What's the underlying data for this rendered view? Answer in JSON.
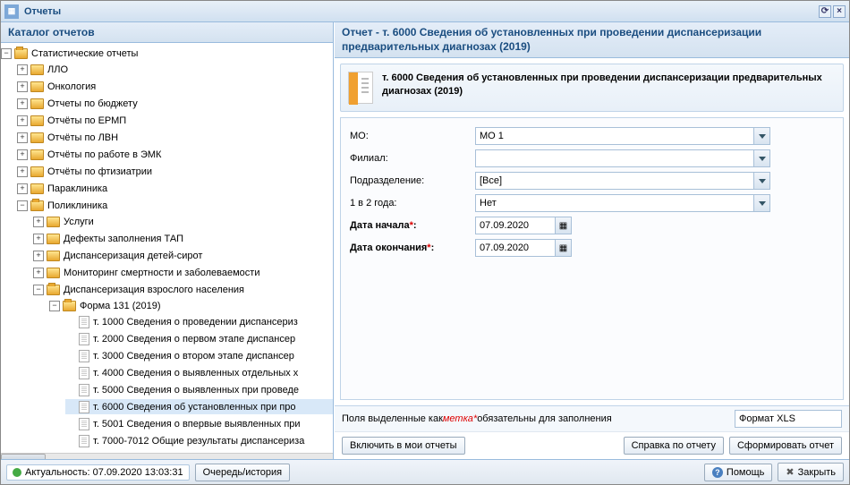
{
  "window": {
    "title": "Отчеты"
  },
  "catalog": {
    "title": "Каталог отчетов",
    "root": "Статистические отчеты",
    "folders": [
      "ЛЛО",
      "Онкология",
      "Отчеты по бюджету",
      "Отчёты по ЕРМП",
      "Отчёты по ЛВН",
      "Отчёты по работе в ЭМК",
      "Отчёты по фтизиатрии",
      "Параклиника"
    ],
    "poli": "Поликлиника",
    "poli_sub": [
      "Услуги",
      "Дефекты заполнения ТАП",
      "Диспансеризация детей-сирот",
      "Мониторинг смертности и заболеваемости"
    ],
    "dvn": "Диспансеризация взрослого населения",
    "form131": "Форма 131 (2019)",
    "docs": [
      "т. 1000 Сведения о проведении диспансериз",
      "т. 2000 Сведения о первом этапе диспансер",
      "т. 3000 Сведения о втором этапе диспансер",
      "т. 4000 Сведения о выявленных отдельных х",
      "т. 5000 Сведения о выявленных при проведе",
      "т. 6000 Сведения об установленных при про",
      "т. 5001 Сведения о впервые выявленных при",
      "т. 7000-7012 Общие результаты диспансериза"
    ],
    "selected_index": 5
  },
  "report": {
    "title": "Отчет - т. 6000 Сведения об установленных при проведении диспансеризации предварительных диагнозах (2019)",
    "info": "т. 6000 Сведения об установленных при проведении диспансеризации предварительных диагнозах (2019)",
    "fields": {
      "mo_label": "МО:",
      "mo_value": "МО 1",
      "filial_label": "Филиал:",
      "filial_value": "",
      "podr_label": "Подразделение:",
      "podr_value": "[Все]",
      "freq_label": "1 в 2 года:",
      "freq_value": "Нет",
      "start_label": "Дата начала",
      "start_value": "07.09.2020",
      "end_label": "Дата окончания",
      "end_value": "07.09.2020"
    },
    "hint_prefix": "Поля выделенные как ",
    "hint_badge": "метка*",
    "hint_suffix": " обязательны для заполнения",
    "format": "Формат XLS"
  },
  "buttons": {
    "include": "Включить в мои отчеты",
    "help_report": "Справка по отчету",
    "form": "Сформировать отчет",
    "queue": "Очередь/история",
    "help": "Помощь",
    "close": "Закрыть"
  },
  "status": {
    "text": "Актуальность: 07.09.2020 13:03:31"
  }
}
